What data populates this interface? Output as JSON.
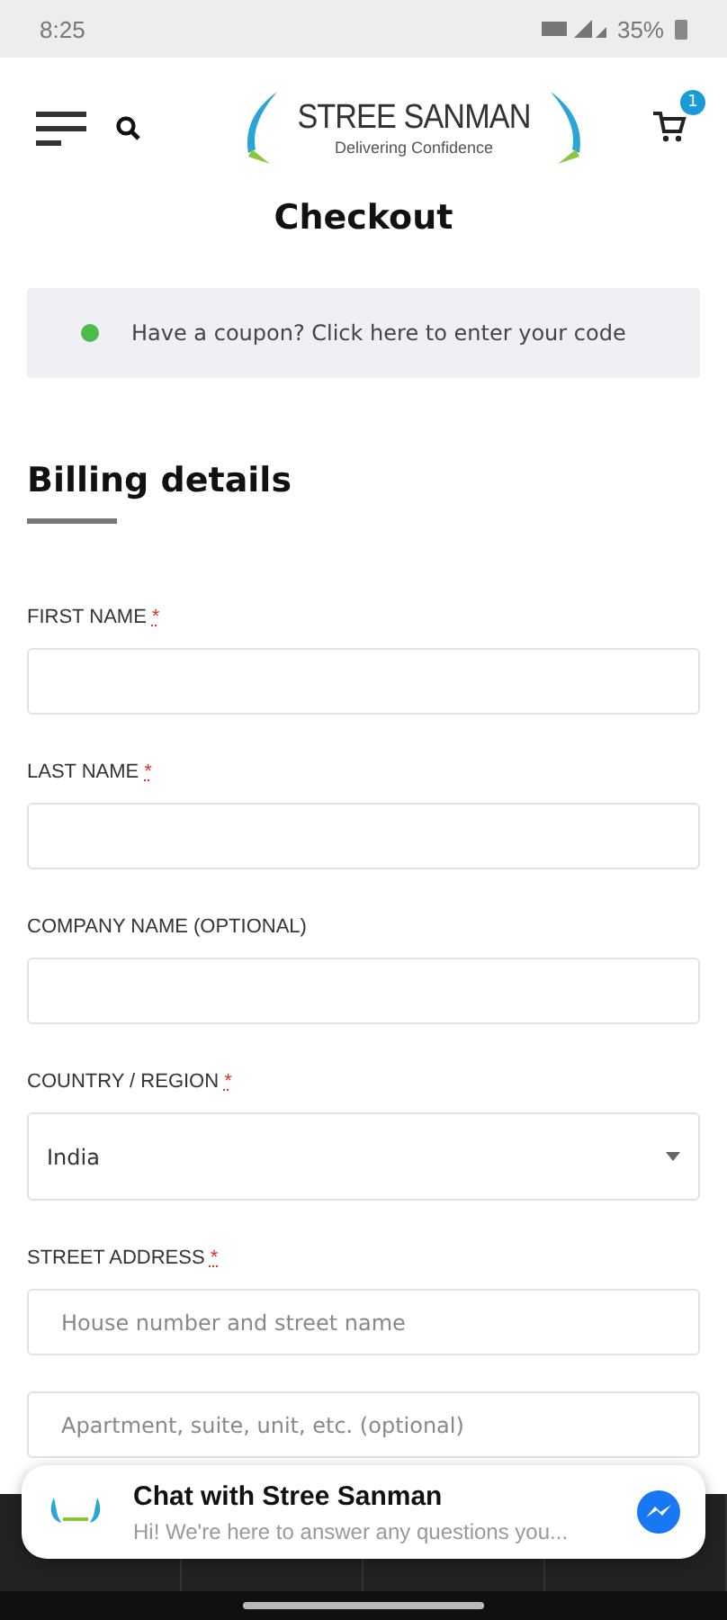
{
  "status_bar": {
    "time": "8:25",
    "battery": "35%"
  },
  "header": {
    "logo_title": "STREE SANMAN",
    "logo_tagline": "Delivering Confidence",
    "cart_count": "1"
  },
  "page_title": "Checkout",
  "coupon_notice": "Have a coupon? Click here to enter your code",
  "section_title": "Billing details",
  "fields": [
    {
      "kind": "text",
      "label": "FIRST NAME",
      "required": true
    },
    {
      "kind": "text",
      "label": "LAST NAME",
      "required": true
    },
    {
      "kind": "text",
      "label": "COMPANY NAME (OPTIONAL)",
      "required": false
    },
    {
      "kind": "select",
      "label": "COUNTRY / REGION",
      "required": true,
      "value": "India"
    },
    {
      "kind": "address",
      "label": "STREET ADDRESS",
      "required": true,
      "placeholder": "House number and street name",
      "placeholder_2": "Apartment, suite, unit, etc. (optional)"
    }
  ],
  "required_mark": "*",
  "chat": {
    "title": "Chat with Stree Sanman",
    "message": "Hi! We're here to answer any questions you..."
  }
}
